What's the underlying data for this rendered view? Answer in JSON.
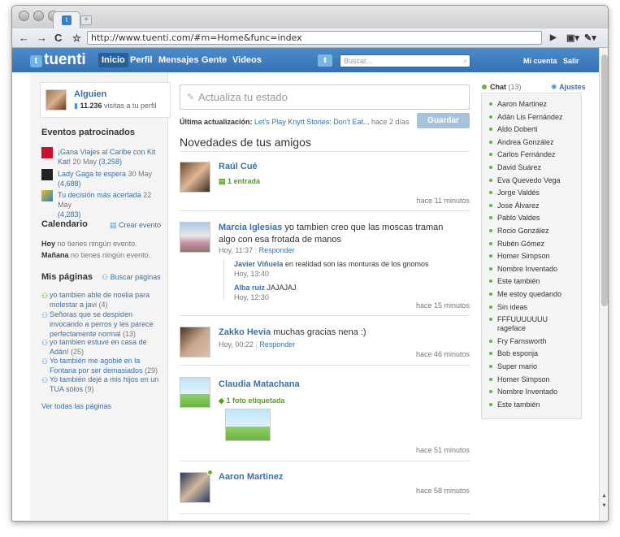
{
  "browser": {
    "url": "http://www.tuenti.com/#m=Home&func=index"
  },
  "nav": {
    "logo": "tuenti",
    "links": [
      "Inicio",
      "Perfil",
      "Mensajes",
      "Gente",
      "Videos"
    ],
    "search_placeholder": "Buscar...",
    "mi_cuenta": "Mi cuenta",
    "salir": "Salir"
  },
  "profile": {
    "name": "Alguien",
    "visits_count": "11.236",
    "visits_label": " visitas a tu perfil"
  },
  "sponsored": {
    "title": "Eventos patrocinados",
    "events": [
      {
        "title": "¡Gana Viajes al Caribe con Kit Kat!",
        "date": " 20 May ",
        "count": "(3,258)"
      },
      {
        "title": "Lady Gaga te espera",
        "date": " 30 May ",
        "count": "(4,688)"
      },
      {
        "title": "Tu decisión más acertada",
        "date": " 22 May ",
        "count": "(4,283)"
      }
    ]
  },
  "calendar": {
    "title": "Calendario",
    "create": "Crear evento",
    "hoy_label": "Hoy",
    "hoy_text": " no tienes ningún evento.",
    "manana_label": "Mañana",
    "manana_text": " no tienes ningún evento."
  },
  "pages": {
    "title": "Mis páginas",
    "search": "Buscar páginas",
    "items": [
      {
        "text": "yo tambien able de noelia para molestar a javi",
        "count": " (4)"
      },
      {
        "text": "Señoras que se despiden invocando a perros y les parece perfectamente normal",
        "count": " (13)"
      },
      {
        "text": "yo tambien estuve en casa de Adán!",
        "count": " (25)"
      },
      {
        "text": "Yo también me agobié en la Fontana por ser demasiados",
        "count": " (29)"
      },
      {
        "text": "Yo también dejé a mis hijos en un TUA sólos",
        "count": " (9)"
      }
    ],
    "all": "Ver todas las páginas"
  },
  "composer": {
    "placeholder": "Actualiza tu estado",
    "last_label": "Última actualización: ",
    "last_link": "Let's Play Knytt Stories: Don't Eat...",
    "last_ago": " hace 2 días",
    "save": "Guardar"
  },
  "feed": {
    "title": "Novedades de tus amigos",
    "items": [
      {
        "name": "Raúl Cué",
        "extra": "1 entrada",
        "ago": "hace 11 minutos"
      },
      {
        "name": "Marcia Iglesias",
        "text": " yo tambien creo que las moscas traman algo con esa frotada de manos",
        "time": "Hoy, 11:37",
        "reply": "Responder",
        "ago": "hace 15 minutos",
        "comments": [
          {
            "author": "Javier Viñuela",
            "text": " en realidad son las monturas de los gnomos",
            "time": "Hoy, 13:40"
          },
          {
            "author": "Alba ruiz",
            "text": " JAJAJAJ",
            "time": "Hoy, 12:30"
          }
        ]
      },
      {
        "name": "Zakko Hevia",
        "text": " muchas gracias nena :)",
        "time": "Hoy, 00:22",
        "reply": "Responder",
        "ago": "hace 46 minutos"
      },
      {
        "name": "Claudia Matachana",
        "extra": "1 foto etiquetada",
        "ago": "hace 51 minutos"
      },
      {
        "name": "Aaron Martinez",
        "ago": "hace 58 minutos"
      }
    ]
  },
  "chat": {
    "title": "Chat",
    "count": " (13)",
    "settings": "Ajustes",
    "people": [
      "Aaron Martinez",
      "Adán Lis Fernández",
      "Aldo Doberti",
      "Andrea González",
      "Carlos Fernández",
      "David Suárez",
      "Eva Quevedo Vega",
      "Jorge Valdés",
      "Jose Álvarez",
      "Pablo Valdes",
      "Rocio González",
      "Rubén Gómez",
      "Homer Simpson",
      "Nombre Inventado",
      "Este también",
      "Me estoy quedando",
      "Sin ideas",
      "FFFUUUUUUU rageface",
      "Fry Farnsworth",
      "Bob esponja",
      "Super mario",
      "Homer Simpson",
      "Nombre Inventado",
      "Este también"
    ]
  }
}
